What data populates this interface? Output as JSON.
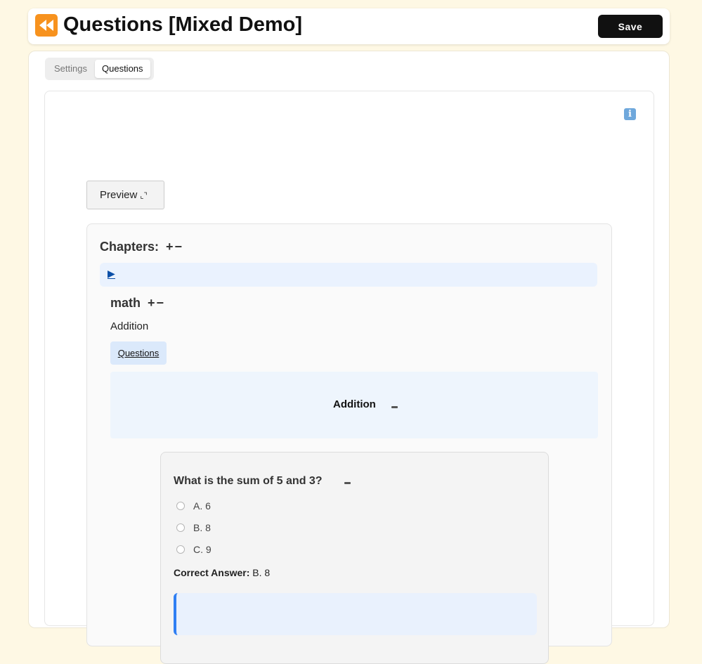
{
  "header": {
    "title_icon": "rewind-icon",
    "title": "Questions [Mixed Demo]",
    "save_label": "Save",
    "accent_color": "#f7921e"
  },
  "tabs": [
    {
      "label": "Settings",
      "active": false
    },
    {
      "label": "Questions",
      "active": true
    }
  ],
  "panel": {
    "info_icon": "info-icon",
    "preview_label": "Preview",
    "chapters": {
      "label": "Chapters:",
      "add_remove": "+−",
      "toggle_icon": "expand-triangle-icon",
      "chapter": {
        "name": "math",
        "add_remove": "+−",
        "subchapter": "Addition",
        "questions_link": "Questions",
        "section_title": "Addition",
        "question": {
          "text": "What is the sum of 5 and 3?",
          "options": [
            "A. 6",
            "B. 8",
            "C. 9"
          ],
          "correct_label": "Correct Answer:",
          "correct_value": "B. 8"
        }
      }
    }
  }
}
